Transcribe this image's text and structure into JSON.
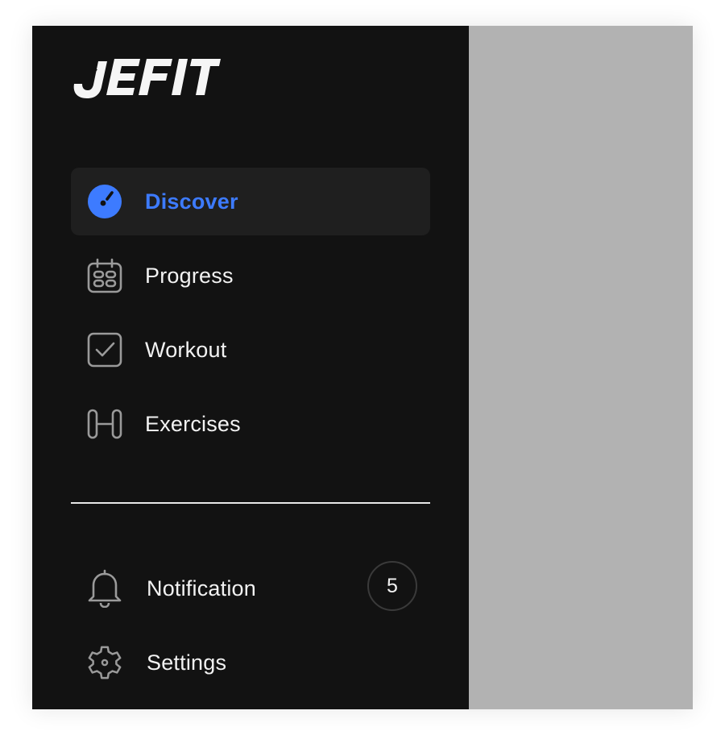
{
  "brand": {
    "logo_text": "JEFIT"
  },
  "nav": {
    "items": [
      {
        "label": "Discover",
        "icon": "compass-icon",
        "active": true
      },
      {
        "label": "Progress",
        "icon": "calendar-icon",
        "active": false
      },
      {
        "label": "Workout",
        "icon": "checkbox-icon",
        "active": false
      },
      {
        "label": "Exercises",
        "icon": "dumbbell-icon",
        "active": false
      }
    ]
  },
  "bottom": {
    "notification": {
      "label": "Notification",
      "icon": "bell-icon",
      "count": "5"
    },
    "settings": {
      "label": "Settings",
      "icon": "gear-icon"
    }
  },
  "colors": {
    "sidebar_bg": "#121212",
    "active_bg": "#1f1f1f",
    "accent": "#3d7bff",
    "overlay": "#b2b2b2",
    "icon_gray": "#9a9a9a"
  }
}
